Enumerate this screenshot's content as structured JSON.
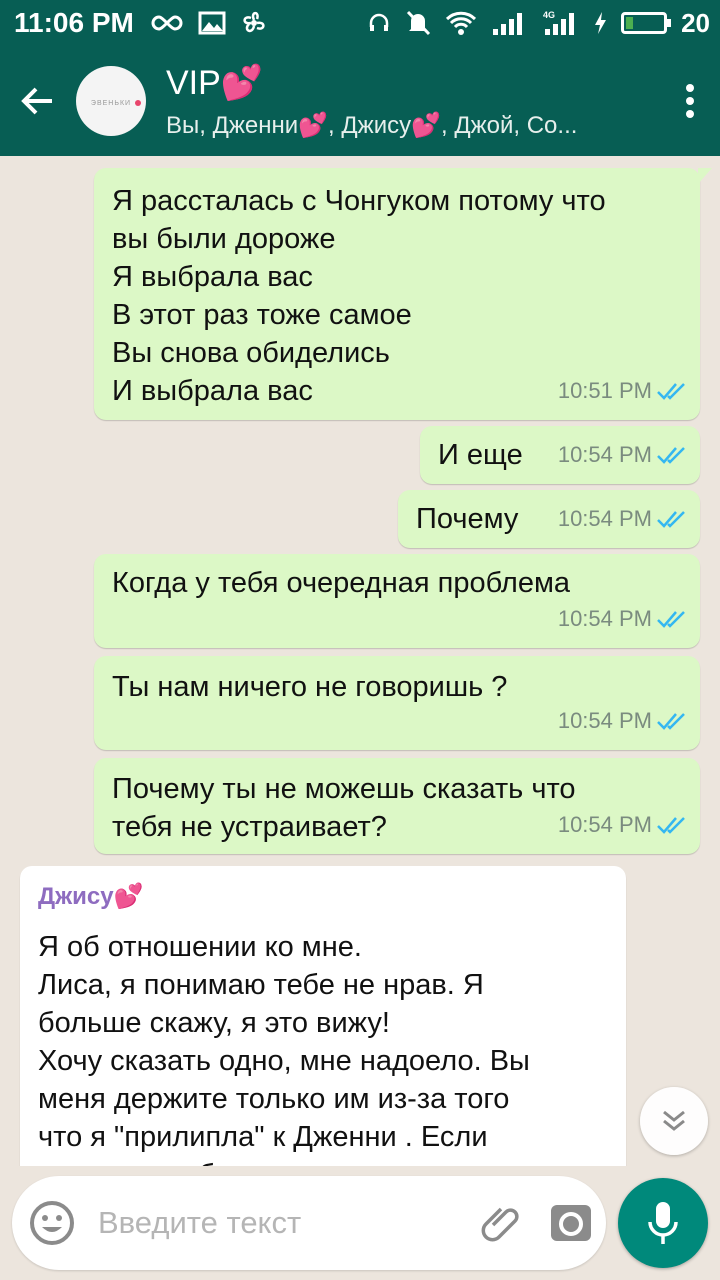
{
  "status_bar": {
    "time": "11:06 PM",
    "battery_percent": "20",
    "network_label": "4G"
  },
  "header": {
    "title": "VIP💕",
    "subtitle": "Вы, Дженни💕, Джису💕, Джой, Со...",
    "avatar_text": "ЭВЕНЬКИ"
  },
  "messages": [
    {
      "type": "out",
      "text": "Я рассталась с Чонгуком потому что\nвы были дороже\nЯ выбрала вас\nВ этот раз тоже самое\nВы снова обиделись\nИ выбрала вас",
      "time": "10:51 PM"
    },
    {
      "type": "out",
      "text": "И еще",
      "time": "10:54 PM"
    },
    {
      "type": "out",
      "text": "Почему",
      "time": "10:54 PM"
    },
    {
      "type": "out",
      "text": "Когда у тебя очередная проблема",
      "time": "10:54 PM"
    },
    {
      "type": "out",
      "text": "Ты нам ничего не говоришь ?",
      "time": "10:54 PM"
    },
    {
      "type": "out",
      "text": "Почему ты не можешь  сказать что\nтебя не устраивает?",
      "time": "10:54 PM"
    },
    {
      "type": "in",
      "sender": "Джису💕",
      "text": "Я об отношении ко мне.\nЛиса, я понимаю тебе не нрав. Я\nбольше скажу, я это вижу!\nХочу сказать одно, мне надоело. Вы\nменя держите только им из-за того\nчто я \"прилипла\" к Дженни . Если\nхотите я не буду с вами ходить"
    }
  ],
  "composer": {
    "placeholder": "Введите текст"
  },
  "colors": {
    "header": "#075e54",
    "outgoing_bubble": "#dcf8c6",
    "incoming_bubble": "#ffffff",
    "chat_bg": "#ece5dd",
    "read_ticks": "#34b7f1",
    "mic_button": "#00897b",
    "sender_name": "#8e6cc0"
  },
  "icons": {
    "back": "arrow-left-icon",
    "menu": "more-vert-icon",
    "emoji": "emoji-icon",
    "attach": "paperclip-icon",
    "camera": "camera-icon",
    "mic": "mic-icon",
    "scroll": "double-chevron-down-icon"
  },
  "battery_level": 0.2
}
